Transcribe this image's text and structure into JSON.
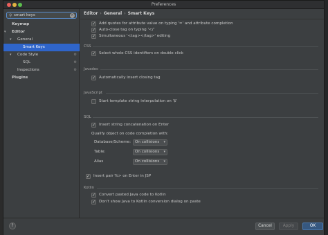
{
  "window": {
    "title": "Preferences"
  },
  "search": {
    "value": "smart keys"
  },
  "tree": [
    {
      "label": "Keymap",
      "bold": true,
      "level": 0
    },
    {
      "label": "Editor",
      "bold": true,
      "level": 0,
      "arrow": "down"
    },
    {
      "label": "General",
      "level": 1,
      "arrow": "down"
    },
    {
      "label": "Smart Keys",
      "level": 2,
      "selected": true
    },
    {
      "label": "Code Style",
      "level": 1,
      "arrow": "down",
      "config": true
    },
    {
      "label": "SQL",
      "level": 2,
      "config": true
    },
    {
      "label": "Inspections",
      "level": 1,
      "config": true
    },
    {
      "label": "Plugins",
      "bold": true,
      "level": 0
    }
  ],
  "breadcrumb": [
    "Editor",
    "General",
    "Smart Keys"
  ],
  "settings": {
    "top": [
      {
        "label": "Add quotes for attribute value on typing '=' and attribute completion",
        "checked": true
      },
      {
        "label": "Auto-close tag on typing '</'",
        "checked": true
      },
      {
        "label": "Simultaneous '<tag></tag>' editing",
        "checked": true
      }
    ],
    "css": {
      "title": "CSS",
      "items": [
        {
          "label": "Select whole CSS identifiers on double click",
          "checked": true
        }
      ]
    },
    "javadoc": {
      "title": "Javadoc",
      "items": [
        {
          "label": "Automatically insert closing tag",
          "checked": true
        }
      ]
    },
    "javascript": {
      "title": "JavaScript",
      "items": [
        {
          "label": "Start template string interpolation on '$'",
          "checked": false
        }
      ]
    },
    "sql": {
      "title": "SQL",
      "items": [
        {
          "label": "Insert string concatenation on Enter",
          "checked": true
        }
      ],
      "qualify_label": "Qualify object on code completion with:",
      "selects": [
        {
          "label": "Database/Scheme:",
          "value": "On collisions"
        },
        {
          "label": "Table:",
          "value": "On collisions"
        },
        {
          "label": "Alias",
          "value": "On collisions"
        }
      ]
    },
    "jsp": {
      "label": "Insert pair %> on Enter in JSP",
      "checked": true
    },
    "kotlin": {
      "title": "Kotlin",
      "items": [
        {
          "label": "Convert pasted Java code to Kotlin",
          "checked": true
        },
        {
          "label": "Don't show Java to Kotlin conversion dialog on paste",
          "checked": true
        }
      ]
    }
  },
  "buttons": {
    "cancel": "Cancel",
    "apply": "Apply",
    "ok": "OK",
    "help": "?"
  },
  "colors": {
    "selection": "#2f65ca",
    "primary_button": "#365880",
    "background": "#3c3f41"
  }
}
